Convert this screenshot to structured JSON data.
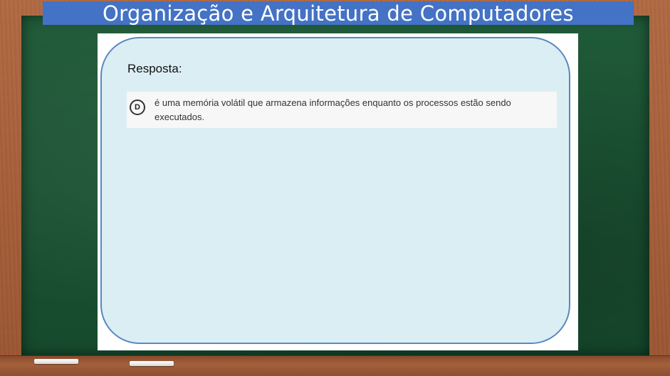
{
  "slide": {
    "title": "Organização e Arquitetura de Computadores"
  },
  "answer": {
    "label": "Resposta:",
    "option": {
      "letter": "D",
      "text": "é uma memória volátil que armazena informações enquanto os processos estão sendo executados."
    }
  },
  "colors": {
    "title_bar": "#4472c4",
    "chalkboard": "#1b5233",
    "frame": "#a65f3a",
    "bubble_fill": "#dbeef4",
    "bubble_border": "#5a88c0"
  }
}
